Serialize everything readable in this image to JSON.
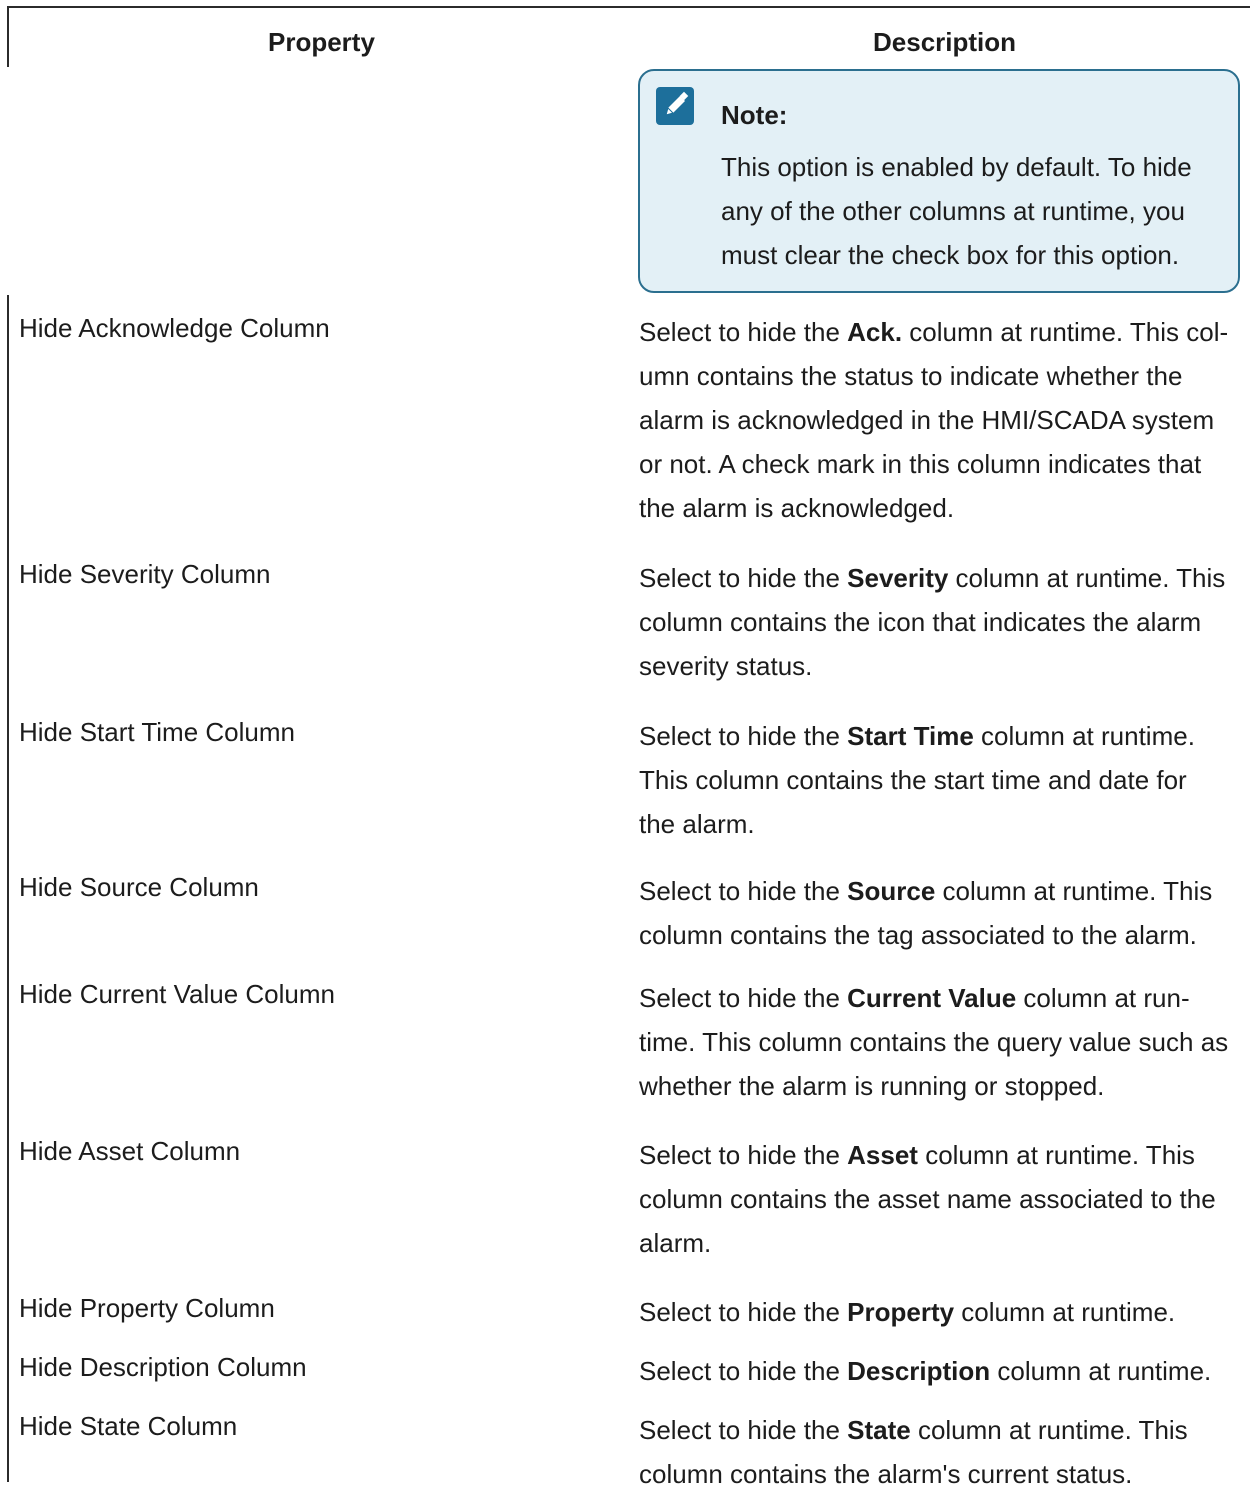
{
  "table": {
    "headers": {
      "property": "Property",
      "description": "Description"
    },
    "note": {
      "icon": "note-pencil-icon",
      "title": "Note:",
      "lines": [
        "This option is enabled by default. To hide",
        "any of the other columns at runtime, you",
        "must clear the check box for this option."
      ]
    },
    "rows": [
      {
        "property": "Hide Acknowledge Column",
        "pre": "Select to hide the ",
        "bold": "Ack.",
        "post": " column at runtime. This col-",
        "lines": [
          "umn contains the status to indicate whether the",
          "alarm is acknowledged in the HMI/SCADA system",
          "or not. A check mark in this column indicates that",
          "the alarm is acknowledged."
        ]
      },
      {
        "property": "Hide Severity Column",
        "pre": "Select to hide the ",
        "bold": "Severity",
        "post": " column at runtime. This",
        "lines": [
          "column contains the icon that indicates the alarm",
          "severity status."
        ]
      },
      {
        "property": "Hide Start Time Column",
        "pre": "Select to hide the ",
        "bold": "Start Time",
        "post": " column at runtime.",
        "lines": [
          "This column contains the start time and date for",
          "the alarm."
        ]
      },
      {
        "property": "Hide Source Column",
        "pre": "Select to hide the ",
        "bold": "Source",
        "post": " column at runtime. This",
        "lines": [
          "column contains the tag associated to the alarm."
        ]
      },
      {
        "property": "Hide Current Value Column",
        "pre": "Select to hide the ",
        "bold": "Current Value",
        "post": " column at run-",
        "lines": [
          "time. This column contains the query value such as",
          "whether the alarm is running or stopped."
        ]
      },
      {
        "property": "Hide Asset Column",
        "pre": "Select to hide the ",
        "bold": "Asset",
        "post": " column at runtime. This",
        "lines": [
          "column contains the asset name associated to the",
          "alarm."
        ]
      },
      {
        "property": "Hide Property Column",
        "pre": "Select to hide the ",
        "bold": "Property",
        "post": " column at runtime.",
        "lines": []
      },
      {
        "property": "Hide Description Column",
        "pre": "Select to hide the ",
        "bold": "Description",
        "post": " column at runtime.",
        "lines": []
      },
      {
        "property": "Hide State Column",
        "pre": "Select to hide the ",
        "bold": "State",
        "post": " column at runtime. This",
        "lines": [
          "column contains the alarm's current status."
        ]
      }
    ]
  }
}
